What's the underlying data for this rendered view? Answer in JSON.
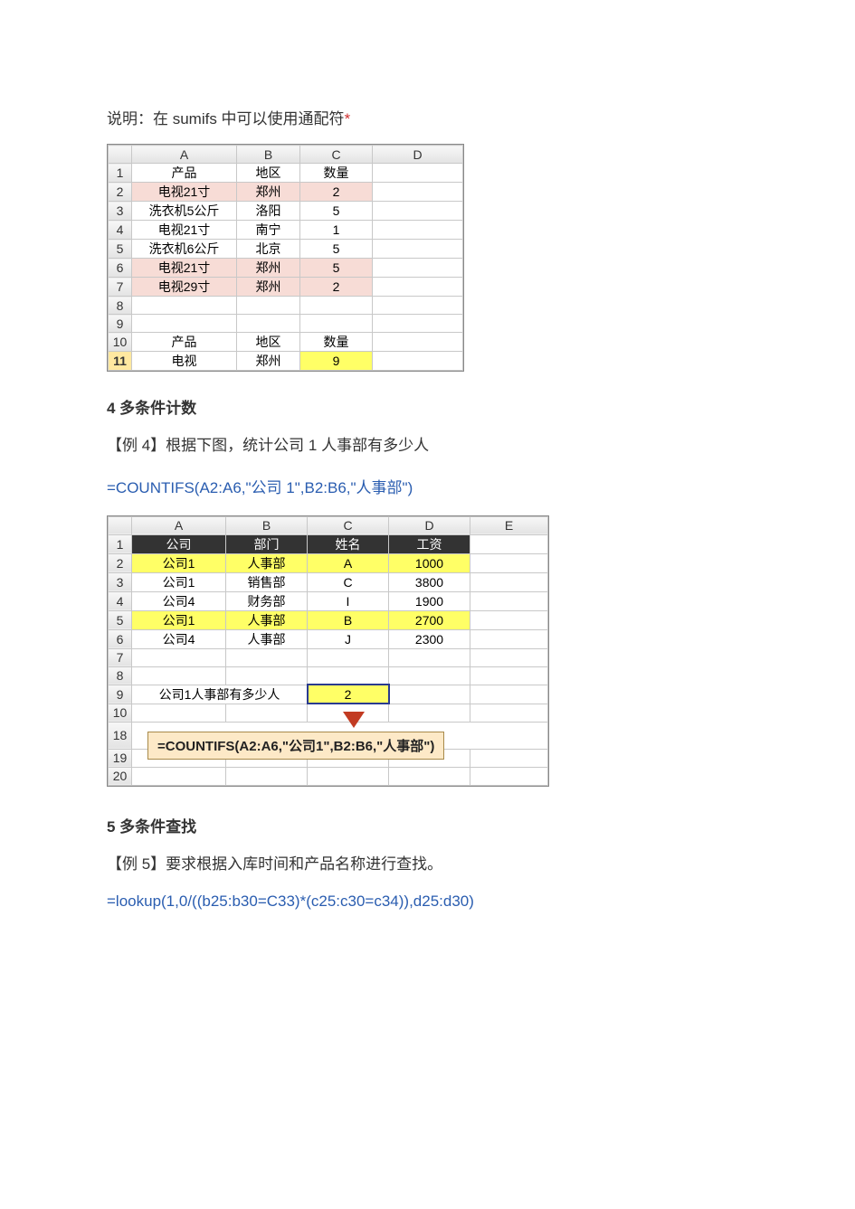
{
  "text": {
    "l1a": "说明：在 sumifs 中可以使用通配符",
    "l1b": "*",
    "sec4": "4 多条件计数",
    "ex4": "【例 4】根据下图，统计公司 1 人事部有多少人",
    "f4": "=COUNTIFS(A2:A6,\"公司 1\",B2:B6,\"人事部\")",
    "sec5": "5 多条件查找",
    "ex5": "【例 5】要求根据入库时间和产品名称进行查找。",
    "f5": "=lookup(1,0/((b25:b30=C33)*(c25:c30=c34)),d25:d30)"
  },
  "t1": {
    "cols": [
      "A",
      "B",
      "C",
      "D"
    ],
    "rows": [
      {
        "n": "1",
        "a": "产品",
        "b": "地区",
        "c": "数量",
        "d": "",
        "hdr": true
      },
      {
        "n": "2",
        "a": "电视21寸",
        "b": "郑州",
        "c": "2",
        "d": "",
        "pink": true
      },
      {
        "n": "3",
        "a": "洗衣机5公斤",
        "b": "洛阳",
        "c": "5",
        "d": ""
      },
      {
        "n": "4",
        "a": "电视21寸",
        "b": "南宁",
        "c": "1",
        "d": ""
      },
      {
        "n": "5",
        "a": "洗衣机6公斤",
        "b": "北京",
        "c": "5",
        "d": ""
      },
      {
        "n": "6",
        "a": "电视21寸",
        "b": "郑州",
        "c": "5",
        "d": "",
        "pink": true
      },
      {
        "n": "7",
        "a": "电视29寸",
        "b": "郑州",
        "c": "2",
        "d": "",
        "pink": true
      },
      {
        "n": "8",
        "a": "",
        "b": "",
        "c": "",
        "d": ""
      },
      {
        "n": "9",
        "a": "",
        "b": "",
        "c": "",
        "d": ""
      },
      {
        "n": "10",
        "a": "产品",
        "b": "地区",
        "c": "数量",
        "d": "",
        "hdr": true
      },
      {
        "n": "11",
        "a": "电视",
        "b": "郑州",
        "c": "9",
        "d": "",
        "res": true
      }
    ]
  },
  "t2": {
    "cols": [
      "A",
      "B",
      "C",
      "D",
      "E"
    ],
    "rows": [
      {
        "n": "1",
        "a": "公司",
        "b": "部门",
        "c": "姓名",
        "d": "工资",
        "e": "",
        "hdr": true
      },
      {
        "n": "2",
        "a": "公司1",
        "b": "人事部",
        "c": "A",
        "d": "1000",
        "e": "",
        "hl": true
      },
      {
        "n": "3",
        "a": "公司1",
        "b": "销售部",
        "c": "C",
        "d": "3800",
        "e": ""
      },
      {
        "n": "4",
        "a": "公司4",
        "b": "财务部",
        "c": "I",
        "d": "1900",
        "e": ""
      },
      {
        "n": "5",
        "a": "公司1",
        "b": "人事部",
        "c": "B",
        "d": "2700",
        "e": "",
        "hl": true
      },
      {
        "n": "6",
        "a": "公司4",
        "b": "人事部",
        "c": "J",
        "d": "2300",
        "e": ""
      },
      {
        "n": "7",
        "a": "",
        "b": "",
        "c": "",
        "d": "",
        "e": ""
      },
      {
        "n": "8",
        "a": "",
        "b": "",
        "c": "",
        "d": "",
        "e": ""
      }
    ],
    "q_row": "9",
    "q_label": "公司1人事部有多少人",
    "q_value": "2",
    "extra_rows": [
      "10",
      "18",
      "19",
      "20"
    ],
    "callout": "=COUNTIFS(A2:A6,\"公司1\",B2:B6,\"人事部\")"
  }
}
